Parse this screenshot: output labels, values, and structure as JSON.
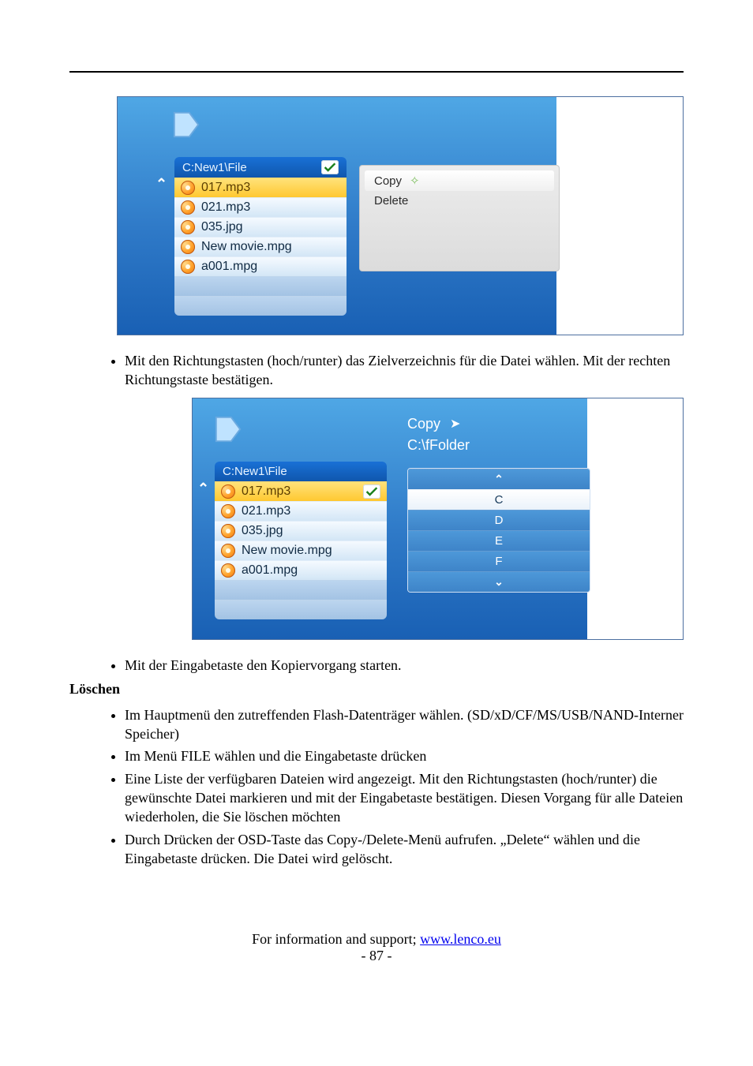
{
  "screenshot1": {
    "path": "C:New1\\File",
    "files": [
      "017.mp3",
      "021.mp3",
      "035.jpg",
      "New movie.mpg",
      "a001.mpg"
    ],
    "selected_index": 0,
    "menu": {
      "copy": "Copy",
      "delete": "Delete"
    }
  },
  "body_text": {
    "bullet1": "Mit den Richtungstasten (hoch/runter) das Zielverzeichnis für die Datei wählen. Mit der rechten Richtungstaste bestätigen."
  },
  "screenshot2": {
    "path": "C:New1\\File",
    "files": [
      "017.mp3",
      "021.mp3",
      "035.jpg",
      "New movie.mpg",
      "a001.mpg"
    ],
    "selected_index": 0,
    "dest_title": "Copy",
    "dest_path": "C:\\fFolder",
    "drives": [
      "C",
      "D",
      "E",
      "F"
    ]
  },
  "after_ss2_bullet": "Mit der Eingabetaste den Kopiervorgang starten.",
  "heading_delete": "Löschen",
  "delete_bullets": [
    "Im Hauptmenü den zutreffenden Flash-Datenträger wählen. (SD/xD/CF/MS/USB/NAND-Interner Speicher)",
    "Im Menü FILE wählen und die Eingabetaste drücken",
    "Eine Liste der verfügbaren Dateien wird angezeigt. Mit den Richtungstasten (hoch/runter) die gewünschte Datei markieren und mit der Eingabetaste bestätigen. Diesen Vorgang für alle Dateien wiederholen, die Sie löschen möchten",
    "Durch Drücken der OSD-Taste das Copy-/Delete-Menü aufrufen. „Delete“ wählen und die Eingabetaste drücken. Die Datei wird gelöscht."
  ],
  "footer": {
    "info_prefix": "For information and support; ",
    "link_text": "www.lenco.eu",
    "page": "- 87 -"
  }
}
